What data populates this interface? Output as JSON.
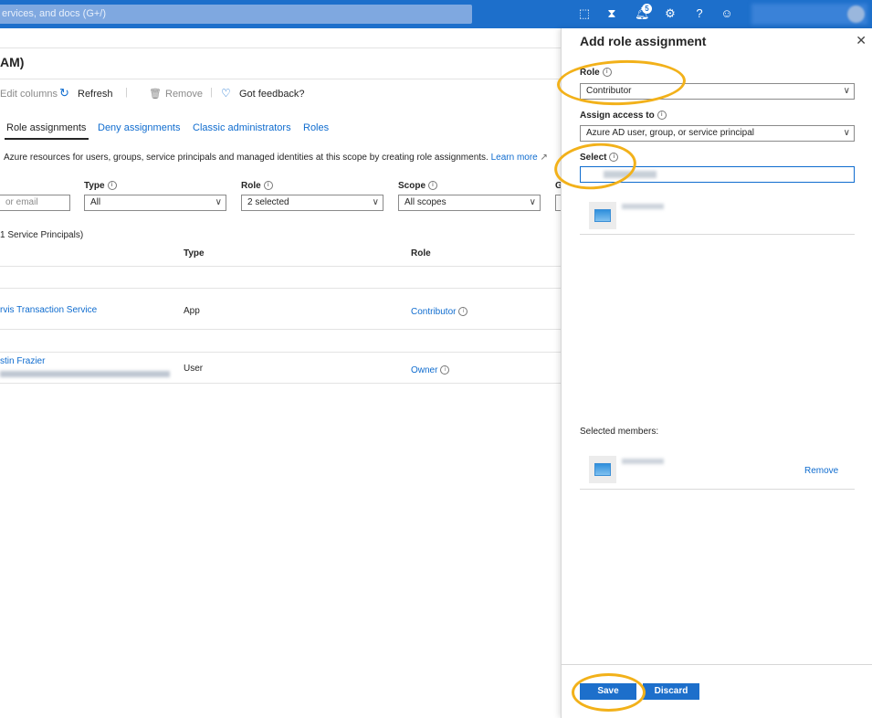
{
  "topbar": {
    "search_placeholder": "ervices, and docs (G+/)",
    "notification_count": "5"
  },
  "page": {
    "title": "AM)",
    "toolbar": {
      "edit_columns": "Edit columns",
      "refresh": "Refresh",
      "remove": "Remove",
      "feedback": "Got feedback?"
    },
    "tabs": [
      "Role assignments",
      "Deny assignments",
      "Classic administrators",
      "Roles"
    ],
    "description": "Azure resources for users, groups, service principals and managed identities at this scope by creating role assignments.",
    "learn_more": "Learn more",
    "filters": {
      "name_placeholder": "or email",
      "type_label": "Type",
      "type_value": "All",
      "role_label": "Role",
      "role_value": "2 selected",
      "scope_label": "Scope",
      "scope_value": "All scopes",
      "group_label": "G"
    },
    "count_text": "1 Service Principals)",
    "columns": {
      "type": "Type",
      "role": "Role"
    },
    "rows": [
      {
        "name": "rvis Transaction Service",
        "type": "App",
        "role": "Contributor"
      },
      {
        "name": "stin Frazier",
        "type": "User",
        "role": "Owner"
      }
    ]
  },
  "panel": {
    "title": "Add role assignment",
    "role_label": "Role",
    "role_value": "Contributor",
    "access_label": "Assign access to",
    "access_value": "Azure AD user, group, or service principal",
    "select_label": "Select",
    "selected_members_label": "Selected members:",
    "remove_label": "Remove",
    "save_label": "Save",
    "discard_label": "Discard"
  },
  "colors": {
    "topbar": "#1d6fcb",
    "link": "#0f6ccf",
    "highlight_ring": "#f2b11a"
  }
}
